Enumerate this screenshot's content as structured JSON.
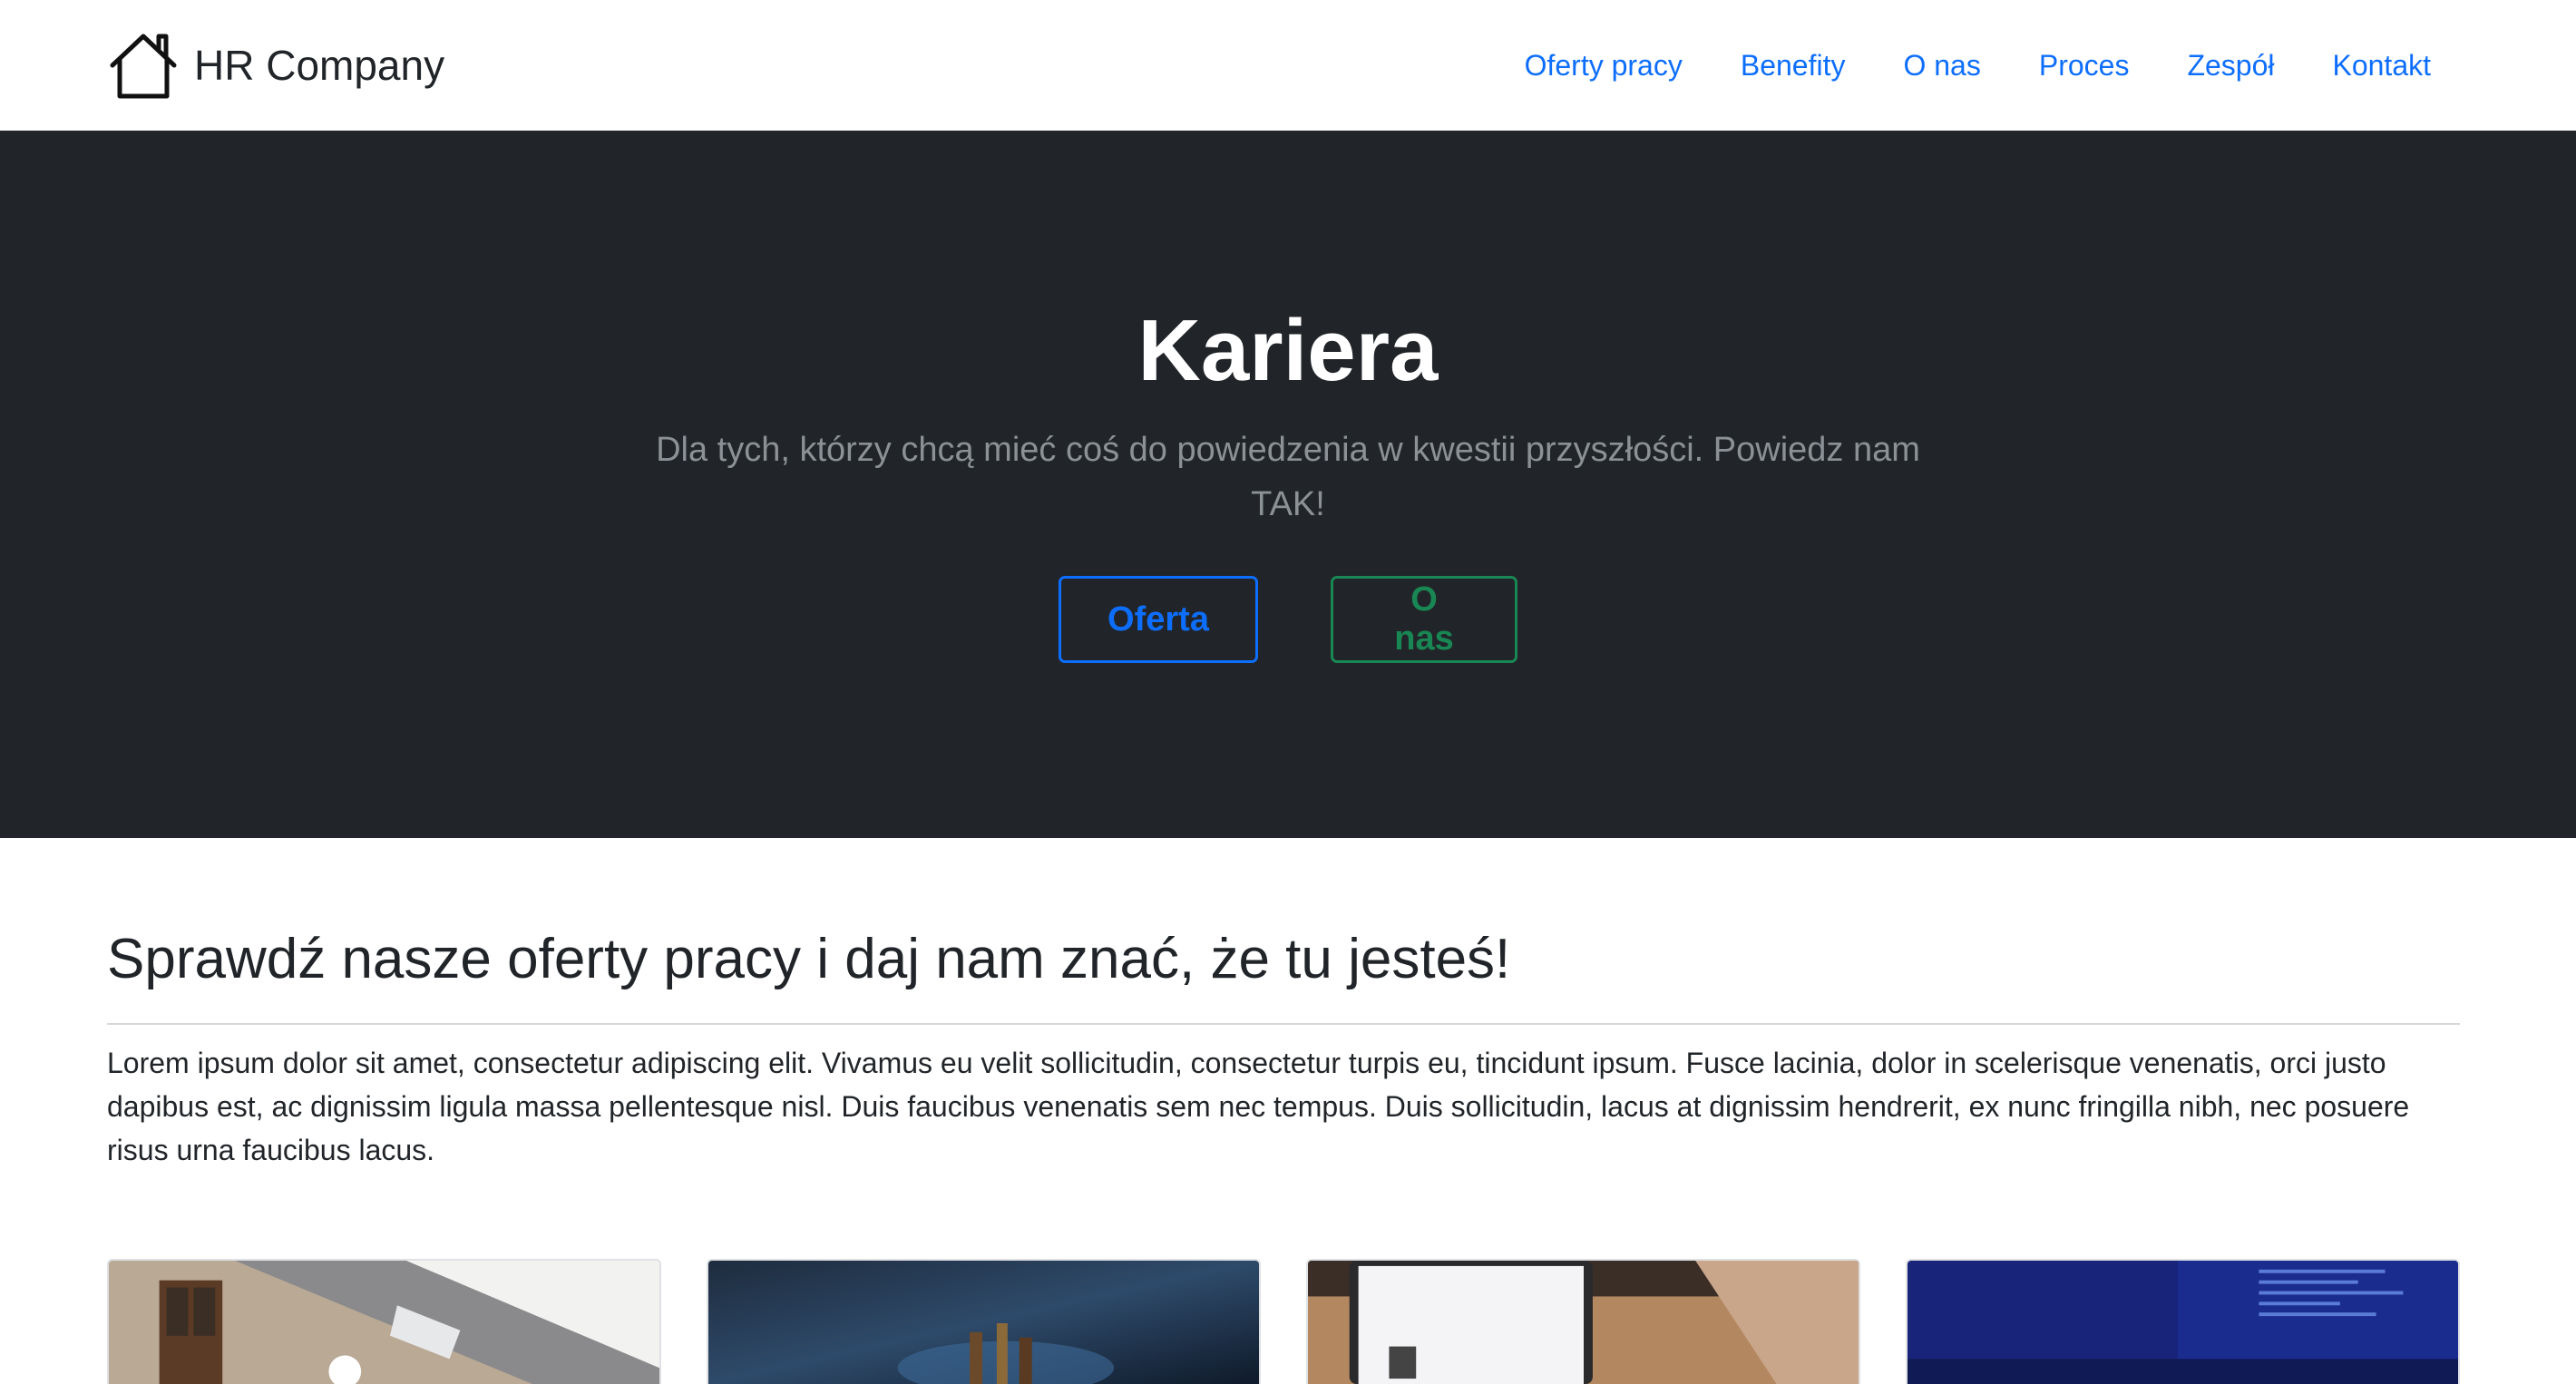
{
  "brand": {
    "name": "HR Company",
    "icon": "house-icon"
  },
  "nav": {
    "items": [
      {
        "label": "Oferty pracy"
      },
      {
        "label": "Benefity"
      },
      {
        "label": "O nas"
      },
      {
        "label": "Proces"
      },
      {
        "label": "Zespół"
      },
      {
        "label": "Kontakt"
      }
    ]
  },
  "hero": {
    "title": "Kariera",
    "lead": "Dla tych, którzy chcą mieć coś do powiedzenia w kwestii przyszłości. Powiedz nam TAK!",
    "primary_button": "Oferta",
    "secondary_button": "O nas"
  },
  "section": {
    "title": "Sprawdź nasze oferty pracy i daj nam znać, że tu jesteś!",
    "text": "Lorem ipsum dolor sit amet, consectetur adipiscing elit. Vivamus eu velit sollicitudin, consectetur turpis eu, tincidunt ipsum. Fusce lacinia, dolor in scelerisque venenatis, orci justo dapibus est, ac dignissim ligula massa pellentesque nisl. Duis faucibus venenatis sem nec tempus. Duis sollicitudin, lacus at dignissim hendrerit, ex nunc fringilla nibh, nec posuere risus urna faucibus lacus."
  },
  "colors": {
    "primary": "#0d6efd",
    "success": "#198754",
    "hero_bg": "#212529",
    "lead_text": "#8c9196"
  }
}
